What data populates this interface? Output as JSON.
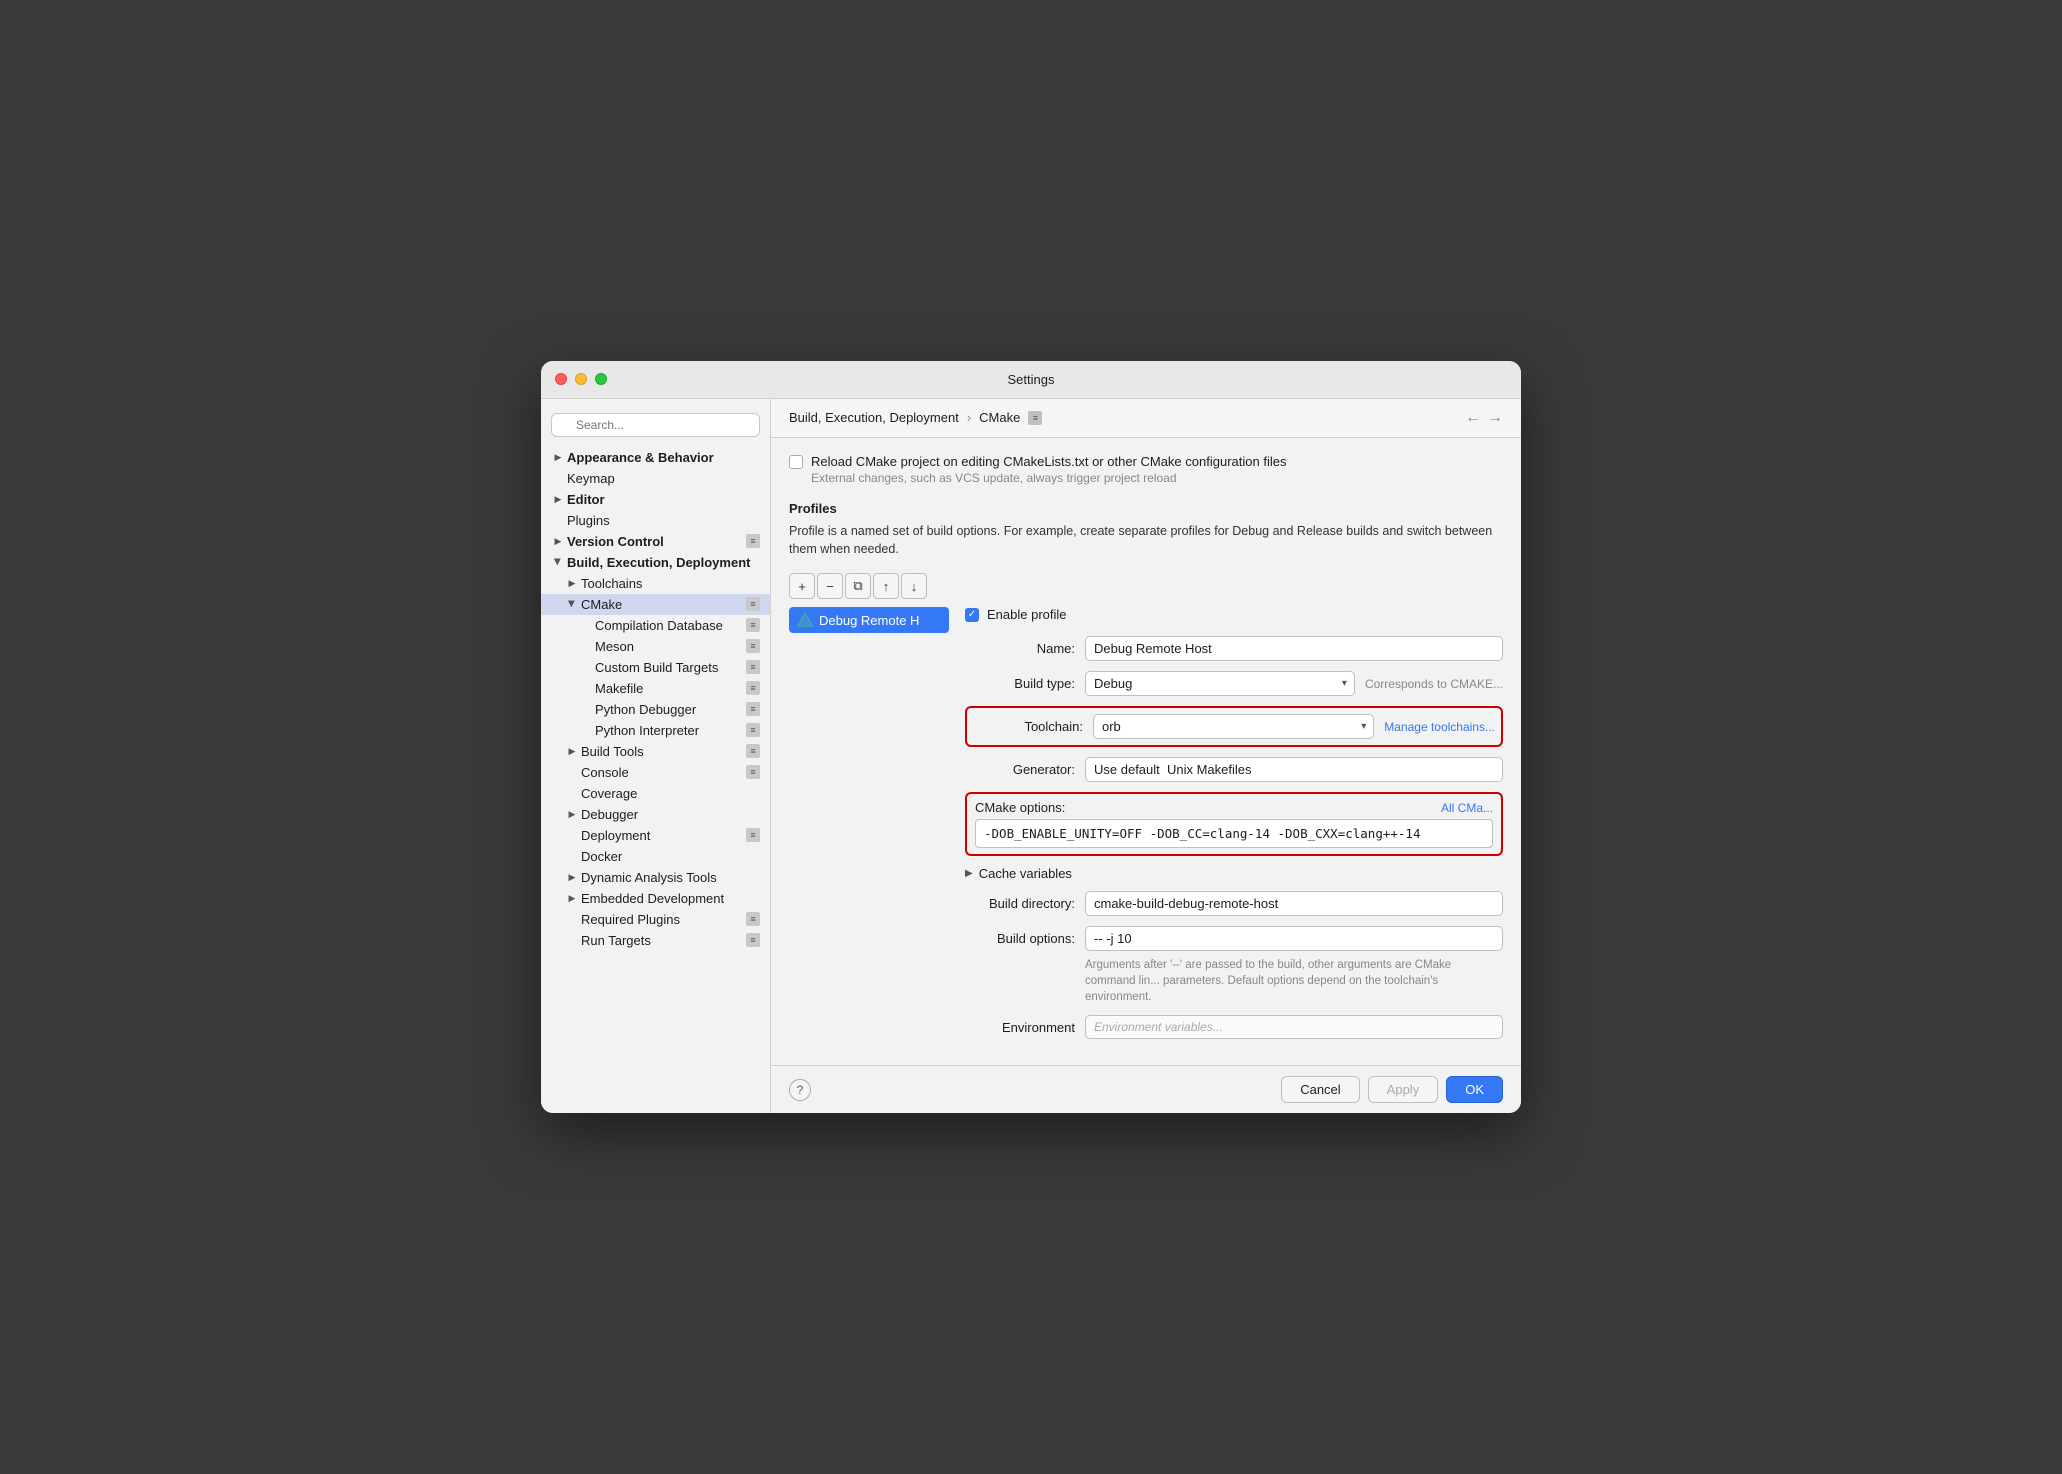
{
  "window": {
    "title": "Settings"
  },
  "sidebar": {
    "search_placeholder": "🔍",
    "items": [
      {
        "id": "appearance",
        "label": "Appearance & Behavior",
        "indent": 0,
        "arrow": "right",
        "bold": true
      },
      {
        "id": "keymap",
        "label": "Keymap",
        "indent": 0,
        "arrow": "",
        "bold": false
      },
      {
        "id": "editor",
        "label": "Editor",
        "indent": 0,
        "arrow": "right",
        "bold": true
      },
      {
        "id": "plugins",
        "label": "Plugins",
        "indent": 0,
        "arrow": "",
        "bold": false
      },
      {
        "id": "version-control",
        "label": "Version Control",
        "indent": 0,
        "arrow": "right",
        "bold": true,
        "badge": true
      },
      {
        "id": "build-exec",
        "label": "Build, Execution, Deployment",
        "indent": 0,
        "arrow": "down",
        "bold": true
      },
      {
        "id": "toolchains",
        "label": "Toolchains",
        "indent": 1,
        "arrow": "right",
        "bold": false
      },
      {
        "id": "cmake",
        "label": "CMake",
        "indent": 1,
        "arrow": "down",
        "bold": false,
        "active": true,
        "badge": true
      },
      {
        "id": "compilation-db",
        "label": "Compilation Database",
        "indent": 2,
        "arrow": "",
        "bold": false,
        "badge": true
      },
      {
        "id": "meson",
        "label": "Meson",
        "indent": 2,
        "arrow": "",
        "bold": false,
        "badge": true
      },
      {
        "id": "custom-build",
        "label": "Custom Build Targets",
        "indent": 2,
        "arrow": "",
        "bold": false,
        "badge": true
      },
      {
        "id": "makefile",
        "label": "Makefile",
        "indent": 2,
        "arrow": "",
        "bold": false,
        "badge": true
      },
      {
        "id": "python-debugger",
        "label": "Python Debugger",
        "indent": 2,
        "arrow": "",
        "bold": false,
        "badge": true
      },
      {
        "id": "python-interpreter",
        "label": "Python Interpreter",
        "indent": 2,
        "arrow": "",
        "bold": false,
        "badge": true
      },
      {
        "id": "build-tools",
        "label": "Build Tools",
        "indent": 1,
        "arrow": "right",
        "bold": false,
        "badge": true
      },
      {
        "id": "console",
        "label": "Console",
        "indent": 1,
        "arrow": "",
        "bold": false,
        "badge": true
      },
      {
        "id": "coverage",
        "label": "Coverage",
        "indent": 1,
        "arrow": "",
        "bold": false
      },
      {
        "id": "debugger",
        "label": "Debugger",
        "indent": 1,
        "arrow": "right",
        "bold": false
      },
      {
        "id": "deployment",
        "label": "Deployment",
        "indent": 1,
        "arrow": "",
        "bold": false,
        "badge": true
      },
      {
        "id": "docker",
        "label": "Docker",
        "indent": 1,
        "arrow": "",
        "bold": false
      },
      {
        "id": "dynamic-analysis",
        "label": "Dynamic Analysis Tools",
        "indent": 1,
        "arrow": "right",
        "bold": false
      },
      {
        "id": "embedded-dev",
        "label": "Embedded Development",
        "indent": 1,
        "arrow": "right",
        "bold": false
      },
      {
        "id": "required-plugins",
        "label": "Required Plugins",
        "indent": 1,
        "arrow": "",
        "bold": false,
        "badge": true
      },
      {
        "id": "run-targets",
        "label": "Run Targets",
        "indent": 1,
        "arrow": "",
        "bold": false,
        "badge": true
      }
    ]
  },
  "breadcrumb": {
    "parent": "Build, Execution, Deployment",
    "separator": "›",
    "current": "CMake",
    "badge_char": "≡"
  },
  "nav": {
    "back": "←",
    "forward": "→"
  },
  "main": {
    "checkbox_label": "Reload CMake project on editing CMakeLists.txt or other CMake configuration files",
    "checkbox_sub": "External changes, such as VCS update, always trigger project reload",
    "profiles_section": "Profiles",
    "profiles_desc": "Profile is a named set of build options. For example, create separate profiles for Debug and Release builds and switch between them when needed.",
    "toolbar": {
      "add": "+",
      "remove": "−",
      "copy": "⧉",
      "up": "↑",
      "down": "↓"
    },
    "profile_name": "Debug Remote H",
    "enable_profile_label": "Enable profile",
    "form": {
      "name_label": "Name:",
      "name_value": "Debug Remote Host",
      "build_type_label": "Build type:",
      "build_type_value": "Debug",
      "build_type_hint": "Corresponds to CMAKE...",
      "toolchain_label": "Toolchain:",
      "toolchain_value": "orb",
      "manage_toolchains": "Manage toolchains...",
      "generator_label": "Generator:",
      "generator_value": "Use default",
      "generator_hint": "Unix Makefiles",
      "cmake_options_label": "CMake options:",
      "cmake_options_value": "-DOB_ENABLE_UNITY=OFF -DOB_CC=clang-14 -DOB_CXX=clang++-14",
      "all_cmake_link": "All CMa...",
      "cache_vars_label": "Cache variables",
      "build_dir_label": "Build directory:",
      "build_dir_value": "cmake-build-debug-remote-host",
      "build_options_label": "Build options:",
      "build_options_value": "-- -j 10",
      "build_options_hint": "Arguments after '--' are passed to the build, other arguments are CMake command lin... parameters. Default options depend on the toolchain's environment.",
      "env_label": "Environment",
      "env_value": "Environment variables..."
    }
  },
  "footer": {
    "cancel": "Cancel",
    "apply": "Apply",
    "ok": "OK"
  },
  "colors": {
    "accent": "#3478f6",
    "danger_border": "#cc0000",
    "active_item": "#c5cfe8",
    "text_primary": "#1d1d1f",
    "text_secondary": "#888888"
  }
}
